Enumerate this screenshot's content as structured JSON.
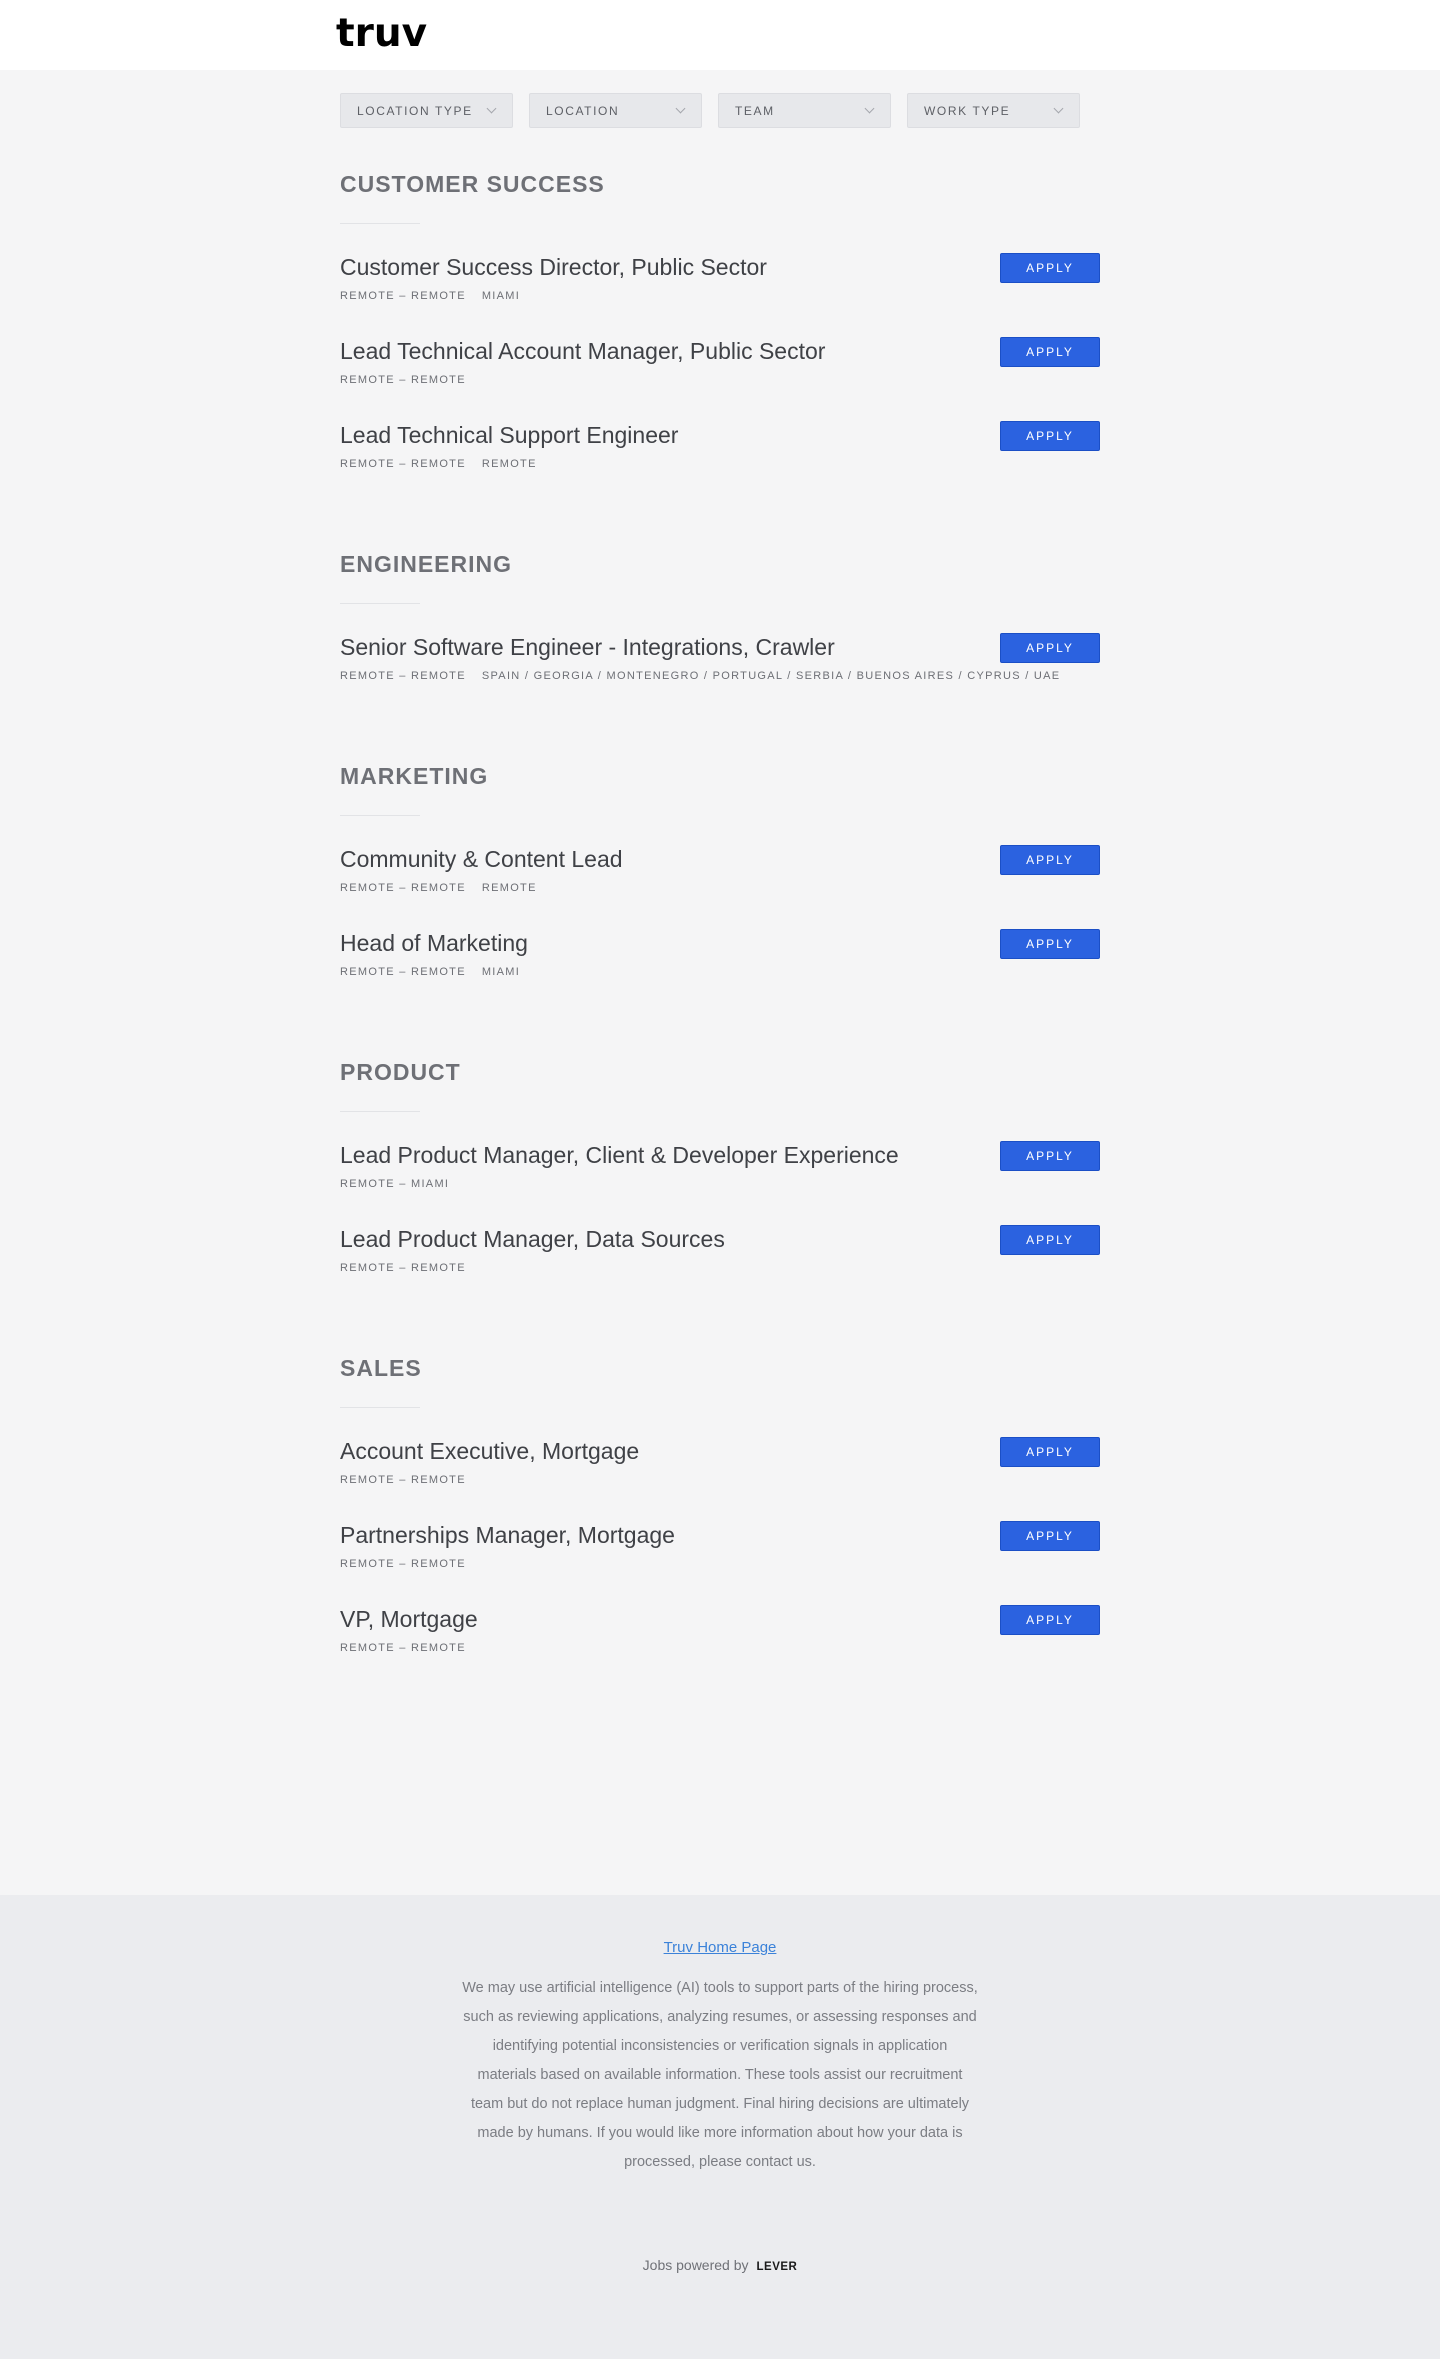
{
  "header": {
    "logo_text": "truv"
  },
  "filters": [
    {
      "label": "LOCATION TYPE"
    },
    {
      "label": "LOCATION"
    },
    {
      "label": "TEAM"
    },
    {
      "label": "WORK TYPE"
    }
  ],
  "groups": [
    {
      "title": "CUSTOMER SUCCESS",
      "postings": [
        {
          "title": "Customer Success Director, Public Sector",
          "cats": [
            "REMOTE – REMOTE",
            "MIAMI"
          ],
          "apply": "APPLY"
        },
        {
          "title": "Lead Technical Account Manager, Public Sector",
          "cats": [
            "REMOTE – REMOTE"
          ],
          "apply": "APPLY"
        },
        {
          "title": "Lead Technical Support Engineer",
          "cats": [
            "REMOTE – REMOTE",
            "REMOTE"
          ],
          "apply": "APPLY"
        }
      ]
    },
    {
      "title": "ENGINEERING",
      "postings": [
        {
          "title": "Senior Software Engineer - Integrations, Crawler",
          "cats": [
            "REMOTE – REMOTE",
            "SPAIN / GEORGIA / MONTENEGRO / PORTUGAL / SERBIA / BUENOS AIRES / CYPRUS / UAE"
          ],
          "apply": "APPLY"
        }
      ]
    },
    {
      "title": "MARKETING",
      "postings": [
        {
          "title": "Community & Content Lead",
          "cats": [
            "REMOTE – REMOTE",
            "REMOTE"
          ],
          "apply": "APPLY"
        },
        {
          "title": "Head of Marketing",
          "cats": [
            "REMOTE – REMOTE",
            "MIAMI"
          ],
          "apply": "APPLY"
        }
      ]
    },
    {
      "title": "PRODUCT",
      "postings": [
        {
          "title": "Lead Product Manager, Client & Developer Experience",
          "cats": [
            "REMOTE – MIAMI"
          ],
          "apply": "APPLY"
        },
        {
          "title": "Lead Product Manager, Data Sources",
          "cats": [
            "REMOTE – REMOTE"
          ],
          "apply": "APPLY"
        }
      ]
    },
    {
      "title": "SALES",
      "postings": [
        {
          "title": "Account Executive, Mortgage",
          "cats": [
            "REMOTE – REMOTE"
          ],
          "apply": "APPLY"
        },
        {
          "title": "Partnerships Manager, Mortgage",
          "cats": [
            "REMOTE – REMOTE"
          ],
          "apply": "APPLY"
        },
        {
          "title": "VP, Mortgage",
          "cats": [
            "REMOTE – REMOTE"
          ],
          "apply": "APPLY"
        }
      ]
    }
  ],
  "footer": {
    "home_link": "Truv Home Page",
    "disclaimer": "We may use artificial intelligence (AI) tools to support parts of the hiring process, such as reviewing applications, analyzing resumes, or assessing responses and identifying potential inconsistencies or verification signals in application materials based on available information. These tools assist our recruitment team but do not replace human judgment. Final hiring decisions are ultimately made by humans. If you would like more information about how your data is processed, please contact us.",
    "powered_by": "Jobs powered by",
    "lever": "LEVER"
  },
  "colors": {
    "apply_button": "#2b62e0",
    "page_background": "#f5f5f6",
    "footer_background": "#ebecef",
    "link": "#3b82d9"
  }
}
